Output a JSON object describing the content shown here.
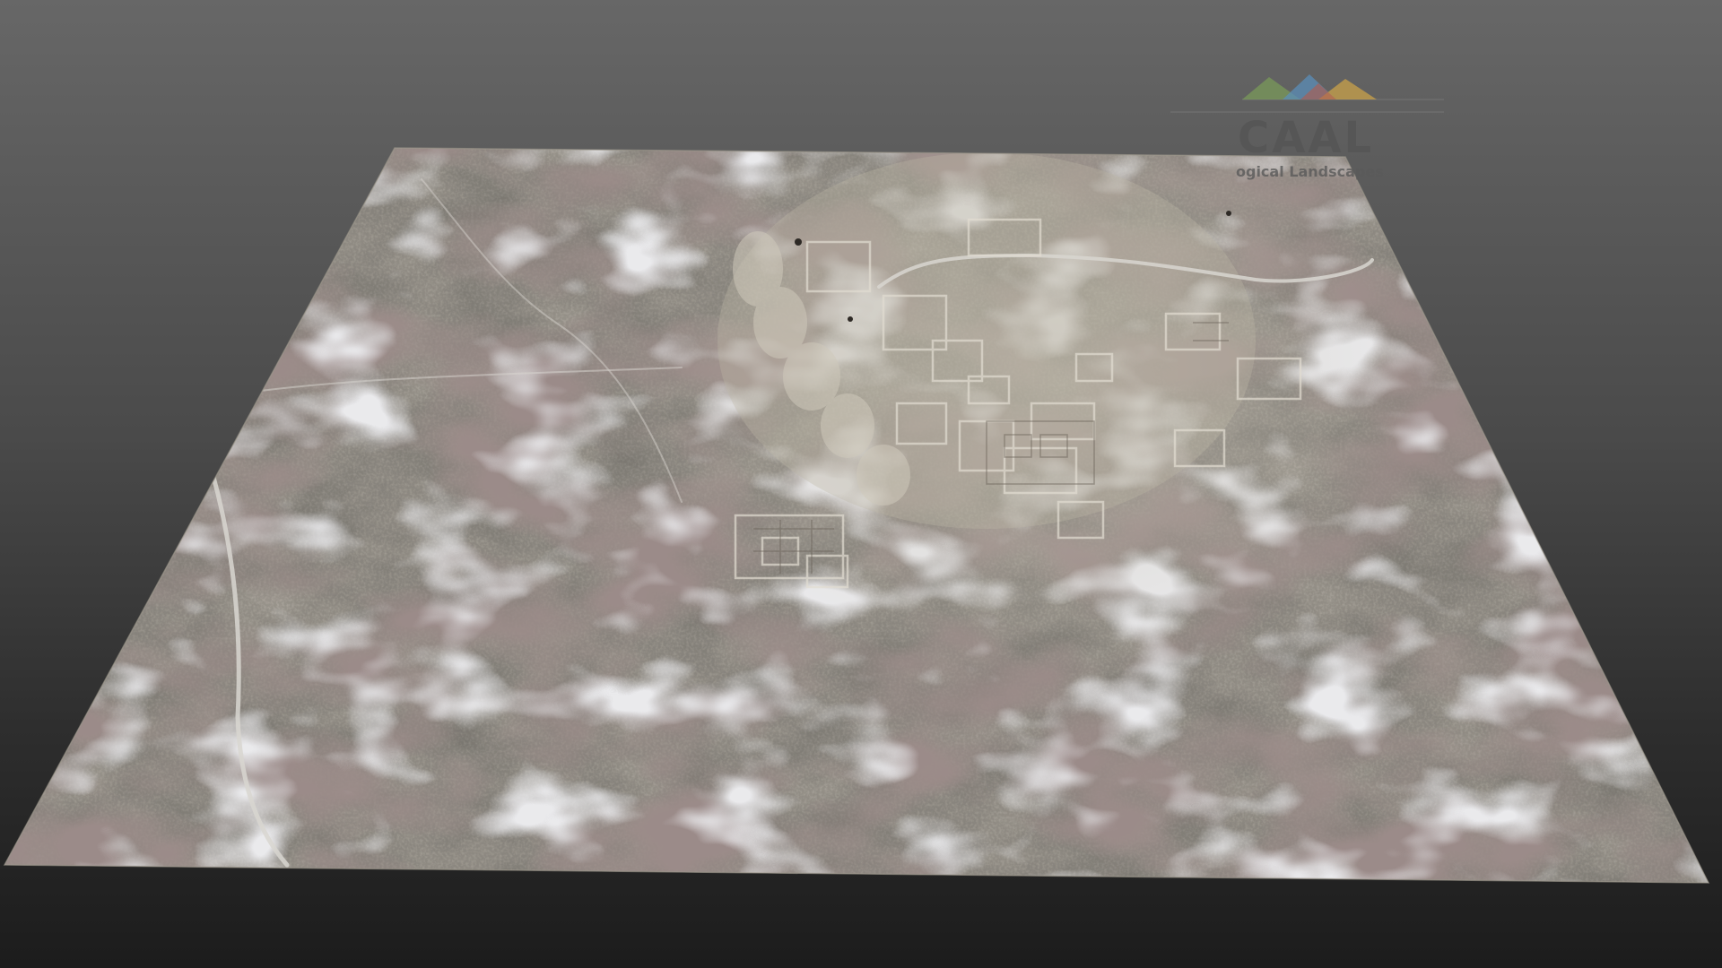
{
  "scene": {
    "description_label": "3D terrain model viewer",
    "background_top": "#676767",
    "background_bottom": "#1c1c1c",
    "terrain_palette": [
      "#8b8372",
      "#9a9284",
      "#6e6a5e",
      "#5a4a48",
      "#b8b4ac",
      "#7c7a5e"
    ]
  },
  "watermark": {
    "title": "CAAL",
    "subtitle": "ogical Landscapes",
    "mark_colors": [
      "#7a9a5a",
      "#5b8db8",
      "#c9a24a",
      "#b25a4a"
    ]
  }
}
